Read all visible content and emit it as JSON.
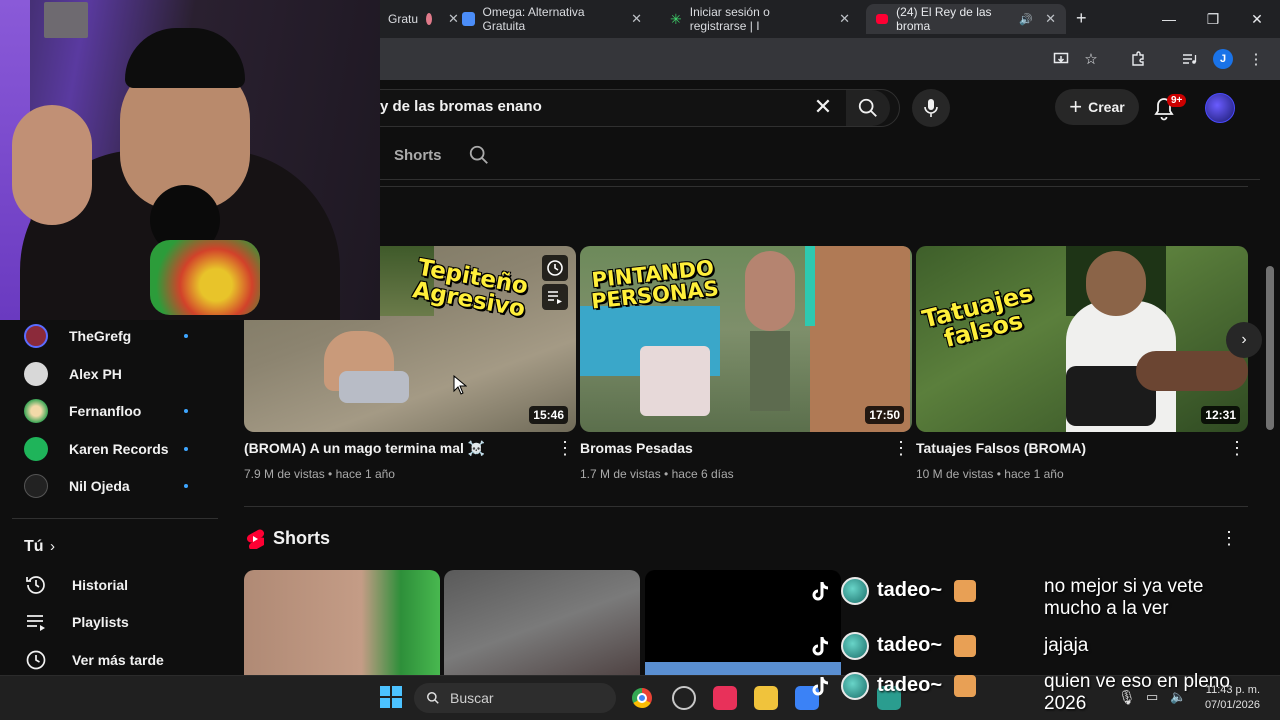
{
  "browser": {
    "tabs": [
      {
        "label": "Gratu"
      },
      {
        "label": "Omega: Alternativa Gratuita"
      },
      {
        "label": "Iniciar sesión o registrarse | I"
      },
      {
        "label": "(24) El Rey de las broma"
      }
    ],
    "new_tab": "+",
    "profile_initial": "J"
  },
  "header": {
    "search_value": "y de las bromas enano",
    "create_label": "Crear",
    "notification_badge": "9+"
  },
  "channel_tabs": {
    "shorts_label": "Shorts"
  },
  "sidebar": {
    "subscriptions": [
      {
        "label": "TheGrefg",
        "color": "#8b2a3a"
      },
      {
        "label": "Alex PH",
        "color": "#d8d8d8"
      },
      {
        "label": "Fernanfloo",
        "color": "#3aa655"
      },
      {
        "label": "Karen Records",
        "color": "#1fb45a"
      },
      {
        "label": "Nil Ojeda",
        "color": "#222222"
      }
    ],
    "you_label": "Tú",
    "you_chevron": "›",
    "nav": [
      {
        "label": "Historial",
        "icon": "history-icon"
      },
      {
        "label": "Playlists",
        "icon": "playlist-icon"
      },
      {
        "label": "Ver más tarde",
        "icon": "watch-later-icon"
      }
    ]
  },
  "videos": [
    {
      "title": "(BROMA) A un mago termina mal ☠️",
      "views": "7.9 M de vistas",
      "age": "hace 1 año",
      "duration": "15:46",
      "overlay": "Tepiteño\nAgresivo"
    },
    {
      "title": "Bromas Pesadas",
      "views": "1.7 M de vistas",
      "age": "hace 6 días",
      "duration": "17:50",
      "overlay": "PINTANDO\nPERSONAS"
    },
    {
      "title": "Tatuajes Falsos (BROMA)",
      "views": "10 M de vistas",
      "age": "hace 1 año",
      "duration": "12:31",
      "overlay": "Tatuajes\nfalsos"
    }
  ],
  "meta_separator": "•",
  "shorts_section": {
    "title": "Shorts"
  },
  "chat": [
    {
      "user": "tadeo~",
      "message": "no mejor si ya vete mucho a la ver"
    },
    {
      "user": "tadeo~",
      "message": "jajaja"
    },
    {
      "user": "tadeo~",
      "message": "quien ve eso en pleno 2026"
    }
  ],
  "taskbar": {
    "search_placeholder": "Buscar",
    "time": "11:43 p. m.",
    "date": "07/01/2026"
  },
  "colors": {
    "background": "#0f0f0f",
    "accent_red": "#ff0033",
    "link_blue": "#3ea6ff"
  }
}
